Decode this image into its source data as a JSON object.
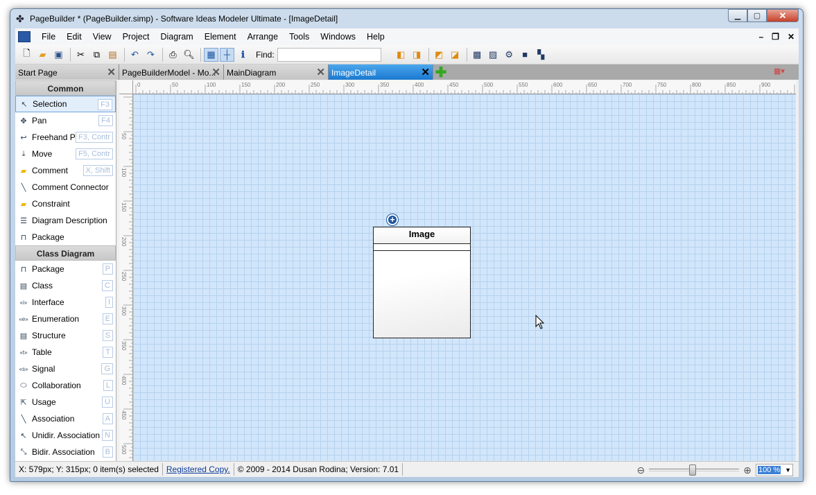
{
  "window": {
    "title": "PageBuilder *  (PageBuilder.simp)  - Software Ideas Modeler Ultimate - [ImageDetail]"
  },
  "menu": [
    "File",
    "Edit",
    "View",
    "Project",
    "Diagram",
    "Element",
    "Arrange",
    "Tools",
    "Windows",
    "Help"
  ],
  "toolbar": {
    "find_label": "Find:",
    "find_value": ""
  },
  "tabs": [
    {
      "label": "Start Page",
      "active": false
    },
    {
      "label": "PageBuilderModel - Mo...",
      "active": false
    },
    {
      "label": "MainDiagram",
      "active": false
    },
    {
      "label": "ImageDetail",
      "active": true
    }
  ],
  "toolbox": {
    "common_header": "Common",
    "common": [
      {
        "label": "Selection",
        "shortcut": "F3",
        "icon": "pointer-icon"
      },
      {
        "label": "Pan",
        "shortcut": "F4",
        "icon": "pan-icon"
      },
      {
        "label": "Freehand Pa",
        "shortcut": "F3, Contr",
        "icon": "freehand-icon"
      },
      {
        "label": "Move",
        "shortcut": "F5, Contr",
        "icon": "move-icon"
      },
      {
        "label": "Comment",
        "shortcut": "X, Shift",
        "icon": "comment-icon"
      },
      {
        "label": "Comment Connector",
        "shortcut": "",
        "icon": "connector-icon"
      },
      {
        "label": "Constraint",
        "shortcut": "",
        "icon": "constraint-icon"
      },
      {
        "label": "Diagram Description",
        "shortcut": "",
        "icon": "description-icon"
      },
      {
        "label": "Package",
        "shortcut": "",
        "icon": "package-icon"
      }
    ],
    "class_header": "Class Diagram",
    "class": [
      {
        "label": "Package",
        "shortcut": "P",
        "icon": "package-icon"
      },
      {
        "label": "Class",
        "shortcut": "C",
        "icon": "class-icon"
      },
      {
        "label": "Interface",
        "shortcut": "I",
        "icon": "interface-icon"
      },
      {
        "label": "Enumeration",
        "shortcut": "E",
        "icon": "enumeration-icon"
      },
      {
        "label": "Structure",
        "shortcut": "S",
        "icon": "structure-icon"
      },
      {
        "label": "Table",
        "shortcut": "T",
        "icon": "table-icon"
      },
      {
        "label": "Signal",
        "shortcut": "G",
        "icon": "signal-icon"
      },
      {
        "label": "Collaboration",
        "shortcut": "L",
        "icon": "collaboration-icon"
      },
      {
        "label": "Usage",
        "shortcut": "U",
        "icon": "usage-icon"
      },
      {
        "label": "Association",
        "shortcut": "A",
        "icon": "association-icon"
      },
      {
        "label": "Unidir. Association",
        "shortcut": "N",
        "icon": "unidir-association-icon"
      },
      {
        "label": "Bidir. Association",
        "shortcut": "B",
        "icon": "bidir-association-icon"
      }
    ]
  },
  "ruler": {
    "h": [
      "0",
      "50",
      "100",
      "150",
      "200",
      "250",
      "300",
      "350",
      "400",
      "450",
      "500",
      "550",
      "600",
      "650",
      "700",
      "750",
      "800",
      "850",
      "900"
    ],
    "v": [
      "50",
      "100",
      "150",
      "200",
      "250",
      "300",
      "350",
      "400",
      "450",
      "500"
    ]
  },
  "diagram": {
    "element_name": "Image"
  },
  "status": {
    "position": "X: 579px; Y: 315px; 0 item(s) selected",
    "registered": "Registered Copy.",
    "copyright": "© 2009 - 2014 Dusan Rodina; Version: 7.01",
    "zoom": "100 %"
  },
  "colors": {
    "canvas": "#d2e6fb",
    "grid": "#b6d2ee",
    "active_tab": "#1b79d0"
  }
}
